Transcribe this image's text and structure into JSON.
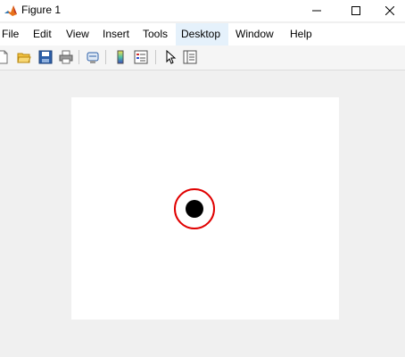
{
  "window": {
    "title": "Figure 1"
  },
  "menu": {
    "items": [
      "File",
      "Edit",
      "View",
      "Insert",
      "Tools",
      "Desktop",
      "Window",
      "Help"
    ],
    "active": "Desktop"
  },
  "toolbar": {
    "buttons": [
      "new-figure",
      "open-file",
      "save-figure",
      "print-figure",
      "link-plot",
      "insert-colorbar",
      "insert-legend",
      "edit-plot",
      "property-inspector"
    ]
  },
  "plot": {
    "marker_colors": {
      "ring": "#e00000",
      "dot": "#000000"
    }
  }
}
